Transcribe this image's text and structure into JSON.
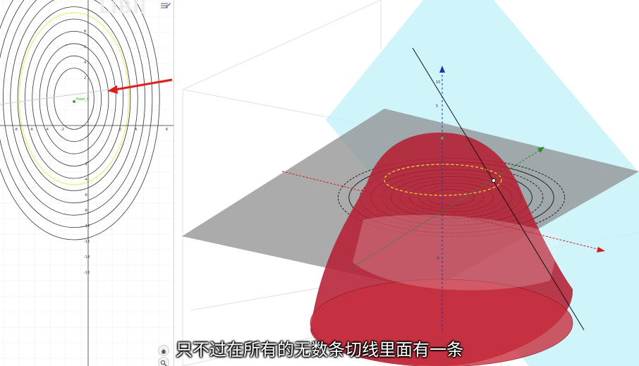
{
  "app": {
    "watermark": "LiBli"
  },
  "graphics2d": {
    "point_label": "fixed_A",
    "x_ticks": [
      "-8",
      "-6",
      "-4",
      "-2",
      "2",
      "4",
      "6"
    ],
    "y_ticks": [
      "8",
      "6",
      "4",
      "2",
      "-2",
      "-4",
      "-6",
      "-8",
      "-10",
      "-12",
      "-14",
      "-16"
    ]
  },
  "graphics3d": {
    "z_ticks": [
      "10",
      "5",
      "-5"
    ]
  },
  "colors": {
    "surface": "#b51f33",
    "tangent_plane": "#bff0f7",
    "xy_plane": "#8f8f8f",
    "annotation_arrow": "#e0201e",
    "highlight_ellipse": "#f2f2a6"
  },
  "icons": {
    "menu": "graphics-menu-icon",
    "home": "home-icon",
    "zoom": "zoom-icon"
  },
  "subtitle": "只不过在所有的无数条切线里面有一条"
}
